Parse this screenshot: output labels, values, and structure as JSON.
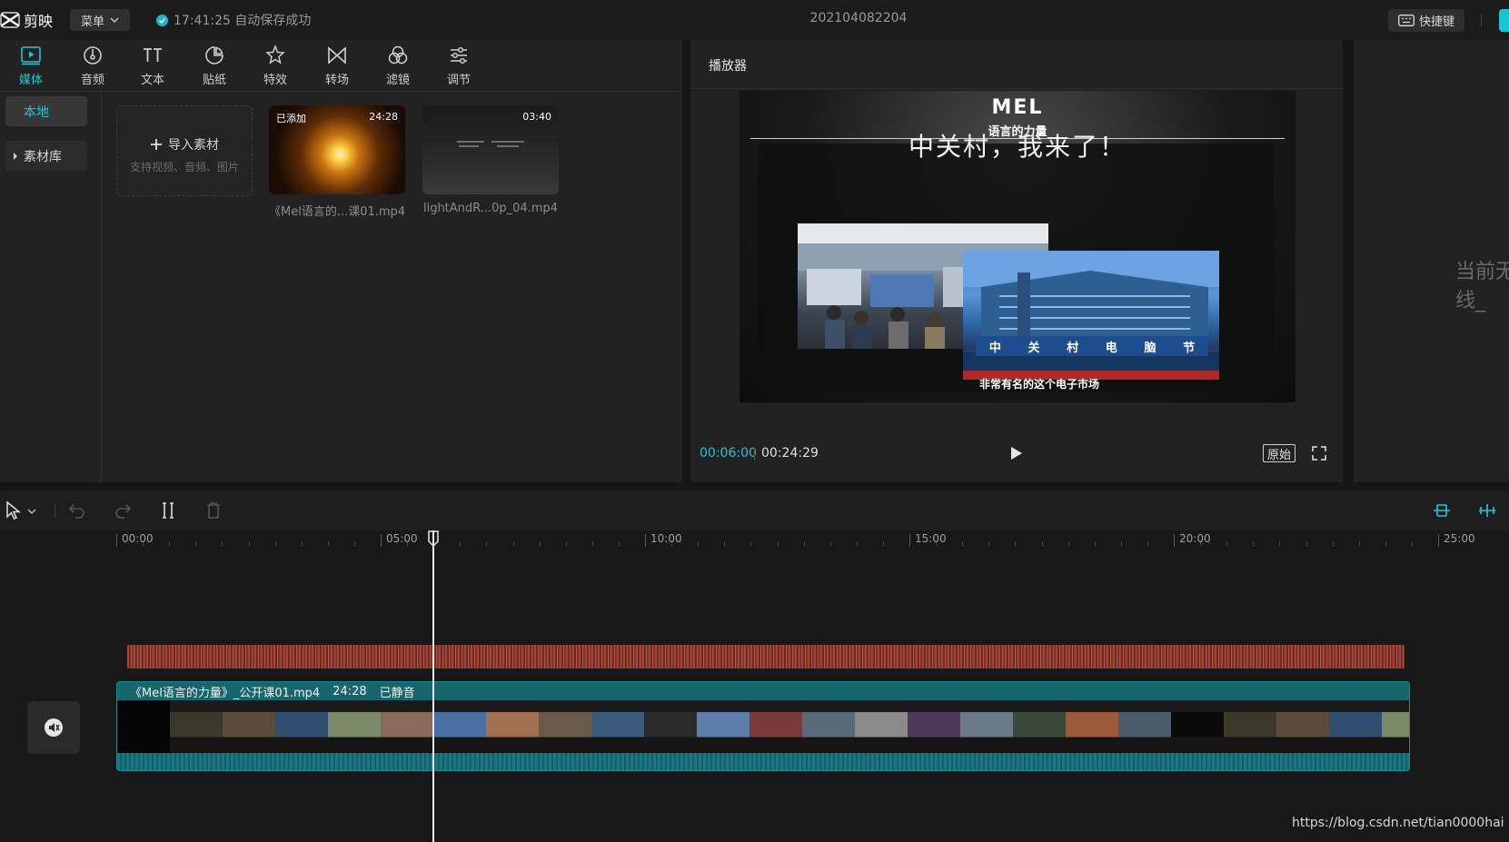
{
  "app": {
    "name": "剪映"
  },
  "topbar": {
    "menu_label": "菜单",
    "save_status": "17:41:25 自动保存成功",
    "project_name": "202104082204",
    "shortcut_label": "快捷键"
  },
  "tool_tabs": [
    {
      "label": "媒体",
      "icon": "media-icon",
      "active": true
    },
    {
      "label": "音频",
      "icon": "audio-icon"
    },
    {
      "label": "文本",
      "icon": "text-icon"
    },
    {
      "label": "贴纸",
      "icon": "sticker-icon"
    },
    {
      "label": "特效",
      "icon": "effects-icon"
    },
    {
      "label": "转场",
      "icon": "transition-icon"
    },
    {
      "label": "滤镜",
      "icon": "filter-icon"
    },
    {
      "label": "调节",
      "icon": "adjust-icon"
    }
  ],
  "left_nav": {
    "local": "本地",
    "library": "素材库"
  },
  "import": {
    "label": "导入素材",
    "hint": "支持视频、音频、图片"
  },
  "media_items": [
    {
      "name": "《Mel语言的...课01.mp4",
      "duration": "24:28",
      "badge": "已添加"
    },
    {
      "name": "lightAndR...0p_04.mp4",
      "duration": "03:40",
      "badge": ""
    }
  ],
  "player": {
    "title": "播放器",
    "frame": {
      "logo": "MEL",
      "logo_sub": "语言的力量",
      "headline": "中关村，我来了！",
      "caption": "非常有名的这个电子市场",
      "sign_text": [
        "中",
        "关",
        "村",
        "电",
        "脑",
        "节"
      ]
    },
    "time_current": "00:06:00",
    "time_total": "00:24:29",
    "ratio_label": "原始"
  },
  "right_panel": {
    "hint": "当前无线_"
  },
  "timeline": {
    "ruler_labels": [
      "00:00",
      "05:00",
      "10:00",
      "15:00",
      "20:00",
      "25:00"
    ],
    "clip": {
      "name": "《Mel语言的力量》_公开课01.mp4",
      "duration": "24:28",
      "status": "已静音"
    },
    "playhead_minutes": 6.0
  },
  "watermark": "https://blog.csdn.net/tian0000hai",
  "colors": {
    "accent": "#1fc7d6",
    "clip": "#17666e",
    "audio": "#a2453a",
    "background": "#161616"
  }
}
